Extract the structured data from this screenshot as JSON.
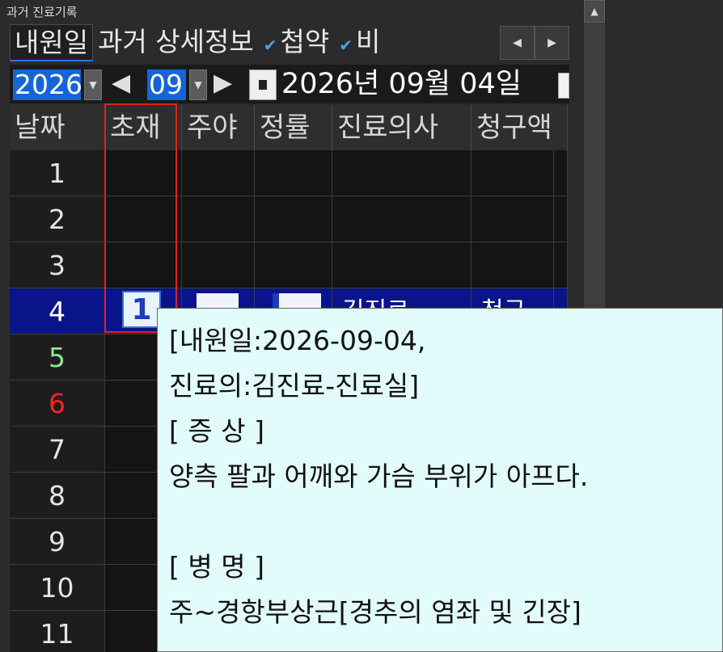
{
  "window": {
    "title": "과거 진료기록"
  },
  "tabs": [
    {
      "label": "내원일",
      "active": true
    },
    {
      "label": "과거 상세정보",
      "active": false
    },
    {
      "label": "첩약",
      "checked": true
    },
    {
      "label": "비",
      "checked": true
    }
  ],
  "tab_scroll": {
    "left": "◀",
    "right": "▶"
  },
  "datebar": {
    "year": "2026",
    "month": "09",
    "prev_arrow": "◀",
    "next_arrow": "▶",
    "date_text": "2026년 09월 04일"
  },
  "table": {
    "columns": [
      "날짜",
      "초재",
      "주야",
      "정률",
      "진료의사",
      "청구액"
    ],
    "rows": [
      {
        "n": "1"
      },
      {
        "n": "2"
      },
      {
        "n": "3"
      },
      {
        "n": "4",
        "selected": true,
        "badge": "1",
        "doctor": "김진료",
        "claim": "청구"
      },
      {
        "n": "5",
        "color": "#8ee88e"
      },
      {
        "n": "6",
        "color": "#ff2020"
      },
      {
        "n": "7"
      },
      {
        "n": "8"
      },
      {
        "n": "9"
      },
      {
        "n": "10"
      },
      {
        "n": "11"
      }
    ]
  },
  "tooltip": {
    "lines": [
      "[내원일:2026-09-04,",
      "진료의:김진료-진료실]",
      "[ 증 상 ]",
      "양측 팔과 어깨와 가슴 부위가 아프다.",
      "",
      "[ 병 명 ]",
      "주~경항부상근[경추의 염좌 및 긴장]"
    ]
  },
  "colors": {
    "selection": "#0a148a",
    "accent": "#1565d8",
    "highlight_box": "#e02020",
    "tooltip_bg": "#e2fbfb"
  }
}
